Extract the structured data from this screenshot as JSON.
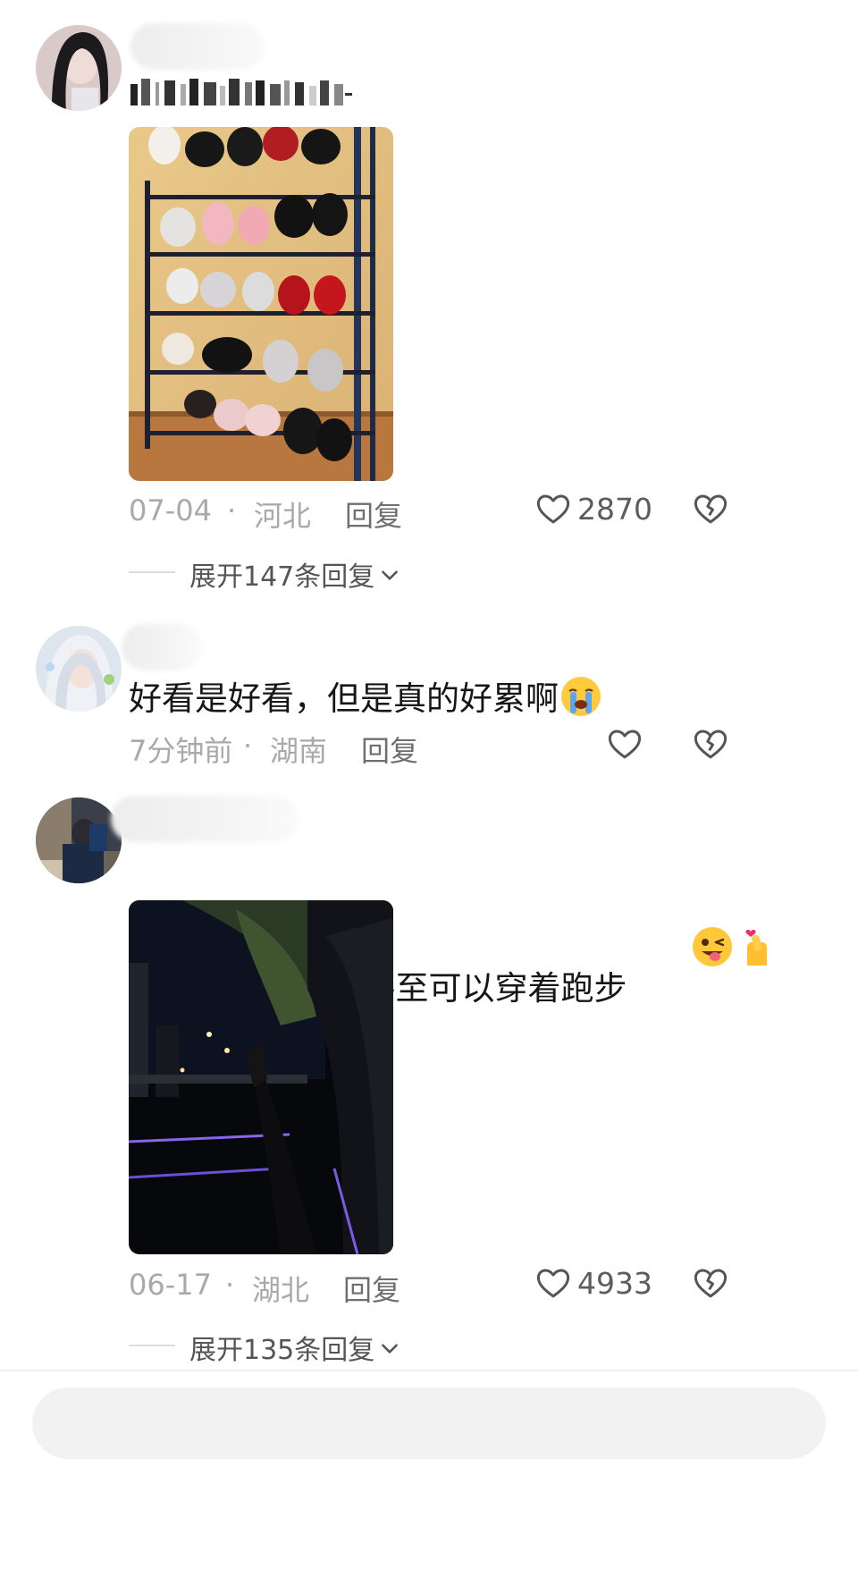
{
  "comments": [
    {
      "date": "07-04",
      "location": "河北",
      "reply_label": "回复",
      "like_count": "2870",
      "expand_label": "展开147条回复"
    },
    {
      "text": "好看是好看，但是真的好累啊",
      "date": "7分钟前",
      "location": "湖南",
      "reply_label": "回复"
    },
    {
      "text": "小小8cm  我甚至可以穿着跑步",
      "date": "06-17",
      "location": "湖北",
      "reply_label": "回复",
      "like_count": "4933",
      "expand_label": "展开135条回复"
    }
  ],
  "separator": "·",
  "icons": {
    "like": "heart-outline-icon",
    "dislike": "broken-heart-icon",
    "expand": "chevron-down-icon"
  },
  "colors": {
    "meta_text": "#a9a9a9",
    "reply_text": "#6f6f6f",
    "body_text": "#161616"
  }
}
